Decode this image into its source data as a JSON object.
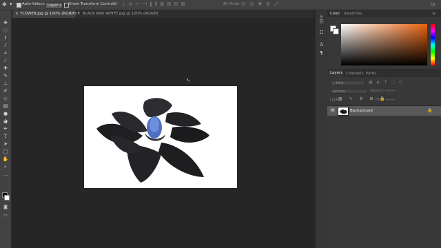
{
  "options_bar": {
    "auto_select_label": "Auto-Select:",
    "auto_select_value": "Layer",
    "show_transform_label": "Show Transform Controls",
    "mode_3d_label": "3D Mode:"
  },
  "tabs": [
    {
      "label": "FLOWER.jpg @ 100% (RGB/8) *",
      "close": "×",
      "active": true
    },
    {
      "label": "BLACK AND WHITE.jpg @ 100% (RGB/8)",
      "close": "×",
      "active": false
    }
  ],
  "tools": [
    "move-icon",
    "marquee-icon",
    "lasso-icon",
    "magic-wand-icon",
    "crop-icon",
    "eyedropper-icon",
    "healing-brush-icon",
    "brush-icon",
    "clone-stamp-icon",
    "history-brush-icon",
    "eraser-icon",
    "gradient-icon",
    "blur-icon",
    "dodge-icon",
    "pen-icon",
    "type-icon",
    "path-selection-icon",
    "shape-icon",
    "hand-icon",
    "zoom-icon",
    "more-tools-icon"
  ],
  "color_panel": {
    "tab_color": "Color",
    "tab_swatches": "Swatches",
    "gradient_hue": "#e8620e"
  },
  "layers_panel": {
    "tab_layers": "Layers",
    "tab_channels": "Channels",
    "tab_paths": "Paths",
    "kind_placeholder": "Kind",
    "blend_mode": "Normal",
    "opacity_label": "Opacity:",
    "lock_label": "Lock:",
    "fill_label": "Fill:",
    "layer_name": "Background"
  },
  "colors": {
    "accent_blue": "#4f6fc4",
    "canvas": "#ffffff"
  }
}
